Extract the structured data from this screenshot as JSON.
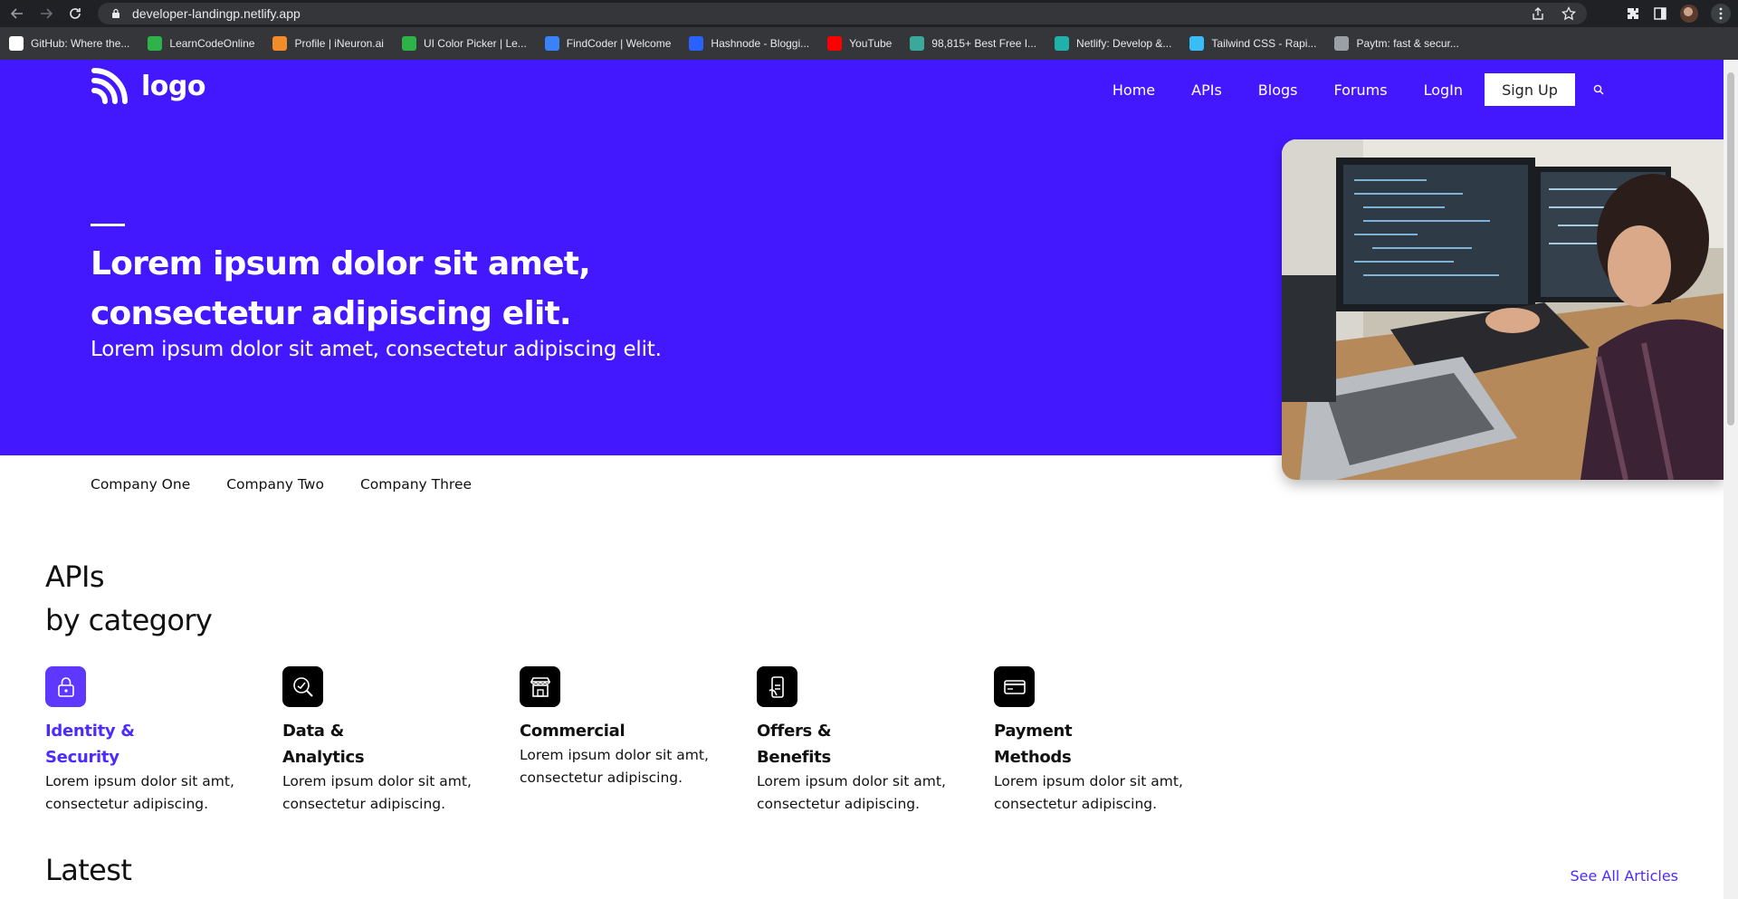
{
  "browser": {
    "url": "developer-landingp.netlify.app",
    "bookmarks": [
      {
        "label": "GitHub: Where the...",
        "icon": "github-icon",
        "color": "#ffffff"
      },
      {
        "label": "LearnCodeOnline",
        "icon": "learncodeonline-icon",
        "color": "#2db34a"
      },
      {
        "label": "Profile | iNeuron.ai",
        "icon": "ineuron-icon",
        "color": "#f28b2a"
      },
      {
        "label": "UI Color Picker | Le...",
        "icon": "ui-color-picker-icon",
        "color": "#2db34a"
      },
      {
        "label": "FindCoder | Welcome",
        "icon": "findcoder-icon",
        "color": "#3b82f6"
      },
      {
        "label": "Hashnode - Bloggi...",
        "icon": "hashnode-icon",
        "color": "#2962ff"
      },
      {
        "label": "YouTube",
        "icon": "youtube-icon",
        "color": "#ff0000"
      },
      {
        "label": "98,815+ Best Free I...",
        "icon": "freepik-icon",
        "color": "#3aa89a"
      },
      {
        "label": "Netlify: Develop &...",
        "icon": "netlify-icon",
        "color": "#20b2aa"
      },
      {
        "label": "Tailwind CSS - Rapi...",
        "icon": "tailwind-icon",
        "color": "#38bdf8"
      },
      {
        "label": "Paytm: fast & secur...",
        "icon": "paytm-icon",
        "color": "#9aa0a6"
      }
    ]
  },
  "header": {
    "logo_text": "logo",
    "nav": [
      "Home",
      "APIs",
      "Blogs",
      "Forums",
      "LogIn"
    ],
    "signup_label": "Sign Up"
  },
  "hero": {
    "title": "Lorem ipsum dolor sit amet, consectetur adipiscing elit.",
    "subtitle": "Lorem ipsum dolor sit amet, consectetur adipiscing elit.",
    "bg_color": "#4318ff"
  },
  "companies": [
    "Company One",
    "Company Two",
    "Company Three"
  ],
  "categories_section": {
    "title_line1": "APIs",
    "title_line2": "by category",
    "items": [
      {
        "name": "Identity & Security",
        "desc": "Lorem ipsum dolor sit amt, consectetur adipiscing.",
        "icon": "lock-icon",
        "active": true
      },
      {
        "name": "Data & Analytics",
        "desc": "Lorem ipsum dolor sit amt, consectetur adipiscing.",
        "icon": "analytics-icon",
        "active": false
      },
      {
        "name": "Commercial",
        "desc": "Lorem ipsum dolor sit amt, consectetur adipiscing.",
        "icon": "store-icon",
        "active": false
      },
      {
        "name": "Offers & Benefits",
        "desc": "Lorem ipsum dolor sit amt, consectetur adipiscing.",
        "icon": "offers-icon",
        "active": false
      },
      {
        "name": "Payment Methods",
        "desc": "Lorem ipsum dolor sit amt, consectetur adipiscing.",
        "icon": "card-icon",
        "active": false
      }
    ],
    "accent_color": "#4b2bff"
  },
  "latest": {
    "title": "Latest",
    "see_all_label": "See All Articles"
  }
}
